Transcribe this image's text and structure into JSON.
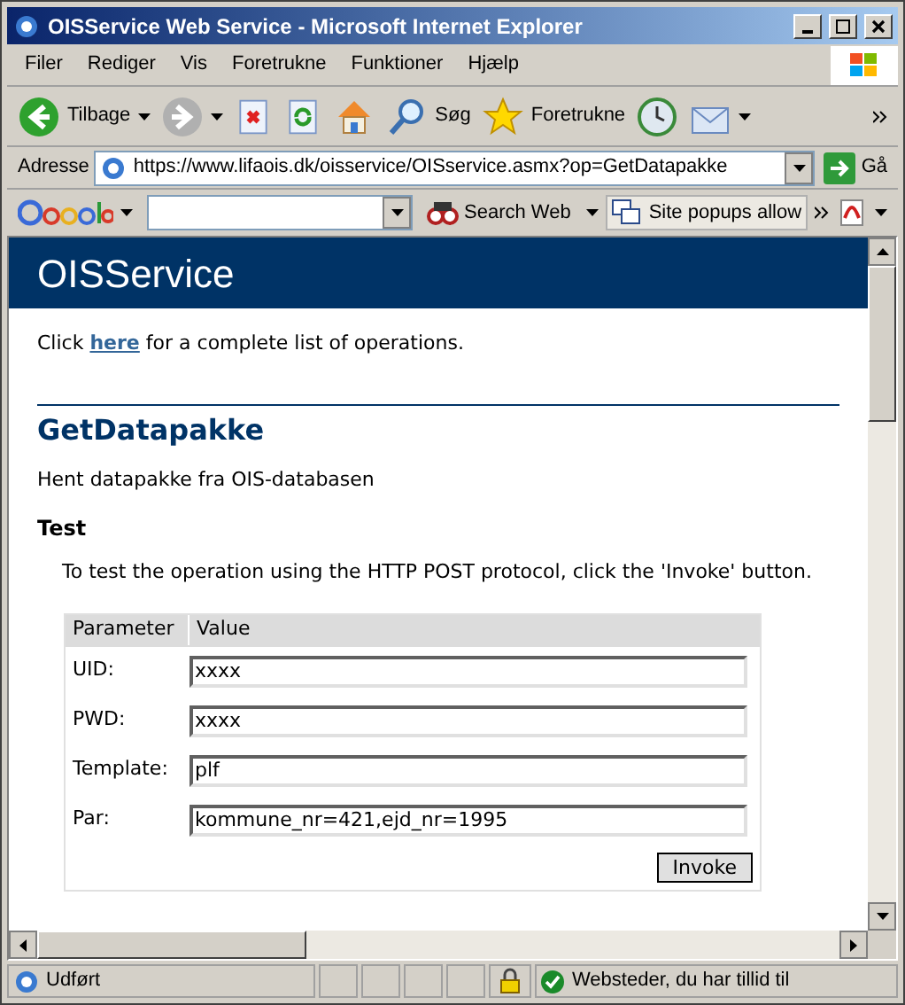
{
  "window": {
    "title": "OISService Web Service - Microsoft Internet Explorer"
  },
  "menu": [
    {
      "label": "Filer"
    },
    {
      "label": "Rediger"
    },
    {
      "label": "Vis"
    },
    {
      "label": "Foretrukne"
    },
    {
      "label": "Funktioner"
    },
    {
      "label": "Hjælp"
    }
  ],
  "toolbar": [
    {
      "kind": "back",
      "label": "Tilbage",
      "disabled": false
    },
    {
      "kind": "forward",
      "disabled": true
    },
    {
      "kind": "stop"
    },
    {
      "kind": "refresh"
    },
    {
      "kind": "home"
    },
    {
      "kind": "search",
      "label": "Søg"
    },
    {
      "kind": "favorites",
      "label": "Foretrukne"
    },
    {
      "kind": "history"
    },
    {
      "kind": "mail"
    }
  ],
  "address": {
    "label": "Adresse",
    "url": "https://www.lifaois.dk/oisservice/OISservice.asmx?op=GetDatapakke",
    "go": "Gå"
  },
  "google_bar": {
    "search_web": "Search Web",
    "popups": "Site popups allow"
  },
  "page": {
    "banner": "OISService",
    "intro_before": "Click",
    "intro_link": "here",
    "intro_after": "for a complete list of operations.",
    "operation": "GetDatapakke",
    "description": "Hent datapakke fra OIS-databasen",
    "test_heading": "Test",
    "test_text": "To test the operation using the HTTP POST protocol, click the 'Invoke' button.",
    "table": {
      "columns": [
        "Parameter",
        "Value"
      ],
      "rows": [
        {
          "label": "UID:",
          "value": "xxxx"
        },
        {
          "label": "PWD:",
          "value": "xxxx"
        },
        {
          "label": "Template:",
          "value": "plf"
        },
        {
          "label": "Par:",
          "value": "kommune_nr=421,ejd_nr=1995"
        }
      ]
    },
    "invoke": "Invoke"
  },
  "status_bar": {
    "text": "Udført",
    "zone": "Websteder, du har tillid til"
  }
}
